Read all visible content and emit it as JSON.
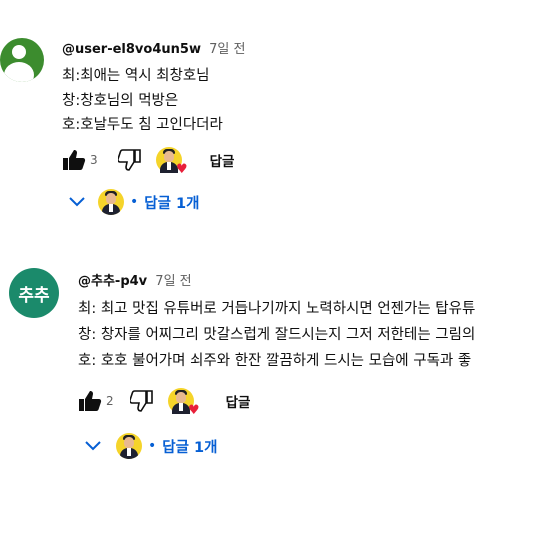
{
  "comments": [
    {
      "author": "@user-el8vo4un5w",
      "time": "7일 전",
      "lines": [
        "최:최애는 역시 최창호님",
        "창:창호님의 먹방은",
        "호:호날두도 침 고인다더라"
      ],
      "likes": "3",
      "reply_label": "답글",
      "replies_label": "답글 1개",
      "avatar_color": "#3c8c2e"
    },
    {
      "author": "@추추-p4v",
      "time": "7일 전",
      "avatar_text": "추추",
      "lines": [
        "최: 최고 맛집 유튜버로 거듭나기까지  노력하시면 언젠가는 탑유튜",
        "창: 창자를 어찌그리 맛갈스럽게  잘드시는지  그저 저한테는 그림의",
        "호: 호호 불어가며  쇠주와 한잔  깔끔하게 드시는 모습에   구독과 좋"
      ],
      "likes": "2",
      "reply_label": "답글",
      "replies_label": "답글 1개",
      "avatar_color": "#1b8a6b"
    }
  ],
  "icons": {
    "like": "thumbs-up-icon",
    "dislike": "thumbs-down-icon",
    "heart": "heart-icon",
    "expand": "chevron-down-icon"
  },
  "colors": {
    "link_blue": "#065fd4",
    "heart_red": "#e8203a"
  }
}
